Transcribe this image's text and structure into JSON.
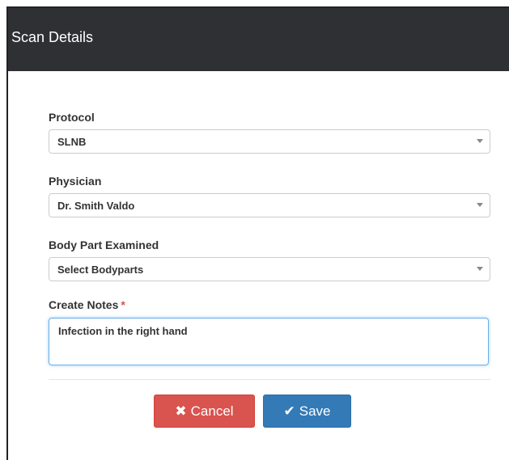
{
  "modal": {
    "title": "Scan Details"
  },
  "form": {
    "protocol": {
      "label": "Protocol",
      "value": "SLNB"
    },
    "physician": {
      "label": "Physician",
      "value": "Dr. Smith Valdo"
    },
    "body_part": {
      "label": "Body Part Examined",
      "value": "Select Bodyparts"
    },
    "notes": {
      "label": "Create Notes",
      "required_mark": "*",
      "value": "Infection in the right hand"
    }
  },
  "buttons": {
    "cancel_icon": "✖",
    "cancel_label": "Cancel",
    "save_icon": "✔",
    "save_label": "Save"
  },
  "colors": {
    "header_bg": "#2f3033",
    "cancel_bg": "#d9534f",
    "save_bg": "#337ab7",
    "required": "#d9534f"
  },
  "icons": {
    "cancel": "times-icon",
    "save": "check-icon",
    "select_arrow": "caret-down-icon"
  }
}
